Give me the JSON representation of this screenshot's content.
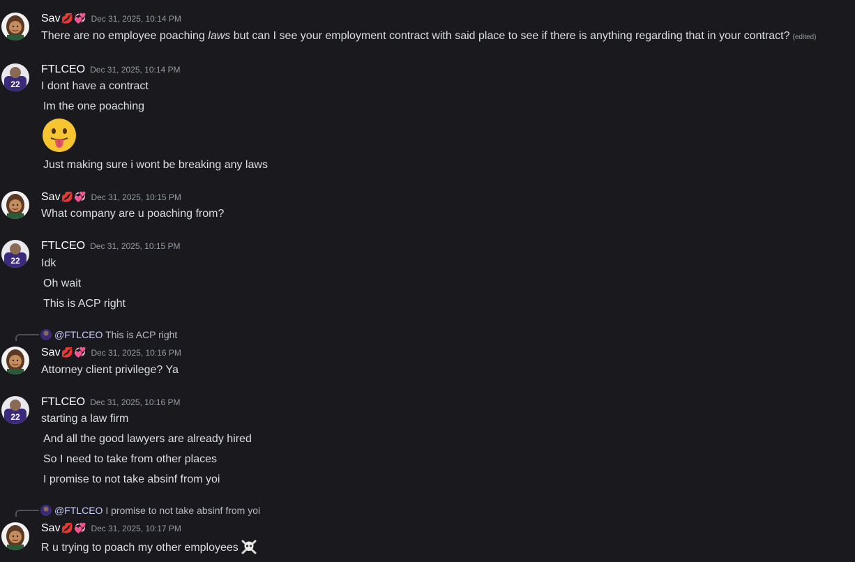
{
  "users": {
    "sav": {
      "name": "Sav",
      "badges": [
        "💋",
        "💞"
      ]
    },
    "ftlceo": {
      "name": "FTLCEO"
    }
  },
  "messages": [
    {
      "author": "Sav",
      "timestamp": "Dec 31, 2025, 10:14 PM",
      "lines": [
        {
          "before": "There are no employee poaching ",
          "italic": "laws",
          "after": " but can I see your employment contract with said place to see if there is anything regarding that in your contract?",
          "edited": "(edited)"
        }
      ]
    },
    {
      "author": "FTLCEO",
      "timestamp": "Dec 31, 2025, 10:14 PM",
      "lines": [
        "I dont have a contract",
        "Im the one poaching",
        "Just making sure i wont be breaking any laws"
      ],
      "emoji": "face-with-tongue"
    },
    {
      "author": "Sav",
      "timestamp": "Dec 31, 2025, 10:15 PM",
      "lines": [
        "What company are u poaching from?"
      ]
    },
    {
      "author": "FTLCEO",
      "timestamp": "Dec 31, 2025, 10:15 PM",
      "lines": [
        "Idk",
        "Oh wait",
        "This is ACP right"
      ]
    },
    {
      "author": "Sav",
      "timestamp": "Dec 31, 2025, 10:16 PM",
      "reply": {
        "mention": "@FTLCEO",
        "text": "This is ACP right"
      },
      "lines": [
        "Attorney client privilege? Ya"
      ]
    },
    {
      "author": "FTLCEO",
      "timestamp": "Dec 31, 2025, 10:16 PM",
      "lines": [
        "starting a law firm",
        "And all the good lawyers are already hired",
        "So I need to take from other places",
        "I promise to not take absinf from yoi"
      ]
    },
    {
      "author": "Sav",
      "timestamp": "Dec 31, 2025, 10:17 PM",
      "reply": {
        "mention": "@FTLCEO",
        "text": "I promise to not take absinf from yoi"
      },
      "lines": [
        "R u trying to poach my other employees"
      ],
      "trailing_emoji": "skull-and-crossbones"
    }
  ]
}
